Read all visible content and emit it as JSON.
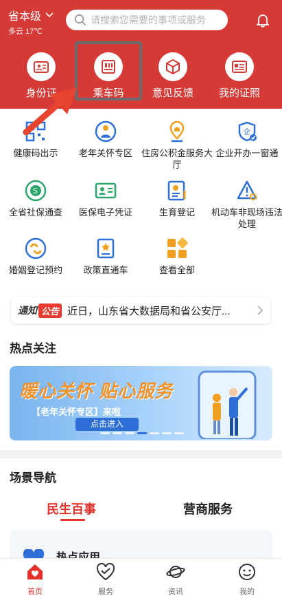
{
  "header": {
    "location": "省本级",
    "weather": "多云 17℃",
    "search_placeholder": "请搜索您需要的事项或服务"
  },
  "quick_links": [
    {
      "label": "身份证",
      "icon": "id-card-icon"
    },
    {
      "label": "乘车码",
      "icon": "bus-code-icon"
    },
    {
      "label": "意见反馈",
      "icon": "feedback-cube-icon"
    },
    {
      "label": "我的证照",
      "icon": "license-icon"
    }
  ],
  "services": [
    {
      "label": "健康码出示",
      "icon": "health-qr-icon"
    },
    {
      "label": "老年关怀专区",
      "icon": "elderly-care-icon"
    },
    {
      "label": "住房公积金服务大厅",
      "icon": "housing-fund-icon"
    },
    {
      "label": "企业开办一窗通",
      "icon": "enterprise-shield-icon"
    },
    {
      "label": "全省社保通查",
      "icon": "social-security-icon"
    },
    {
      "label": "医保电子凭证",
      "icon": "medical-card-icon"
    },
    {
      "label": "生育登记",
      "icon": "birth-register-icon"
    },
    {
      "label": "机动车非现场违法处理",
      "icon": "traffic-warning-icon"
    },
    {
      "label": "婚姻登记预约",
      "icon": "marriage-icon"
    },
    {
      "label": "政策直通车",
      "icon": "policy-doc-icon"
    },
    {
      "label": "查看全部",
      "icon": "all-grid-icon"
    }
  ],
  "notice": {
    "tag_main": "通知",
    "tag_sub": "公告",
    "text": "近日，山东省大数据局和省公安厅..."
  },
  "hot": {
    "title": "热点关注",
    "banner_title": "暖心关怀 贴心服务",
    "banner_sub": "【老年关怀专区】来啦",
    "banner_button": "点击进入"
  },
  "scene": {
    "title": "场景导航",
    "tabs": [
      "民生百事",
      "营商服务"
    ],
    "card_title": "热点应用"
  },
  "tabbar": [
    {
      "label": "首页",
      "icon": "home-icon"
    },
    {
      "label": "服务",
      "icon": "service-heart-icon"
    },
    {
      "label": "资讯",
      "icon": "news-planet-icon"
    },
    {
      "label": "我的",
      "icon": "profile-face-icon"
    }
  ],
  "colors": {
    "brand_red": "#d63a36",
    "accent_red": "#e2322b",
    "blue": "#2d6fd6",
    "orange": "#f0a020"
  }
}
